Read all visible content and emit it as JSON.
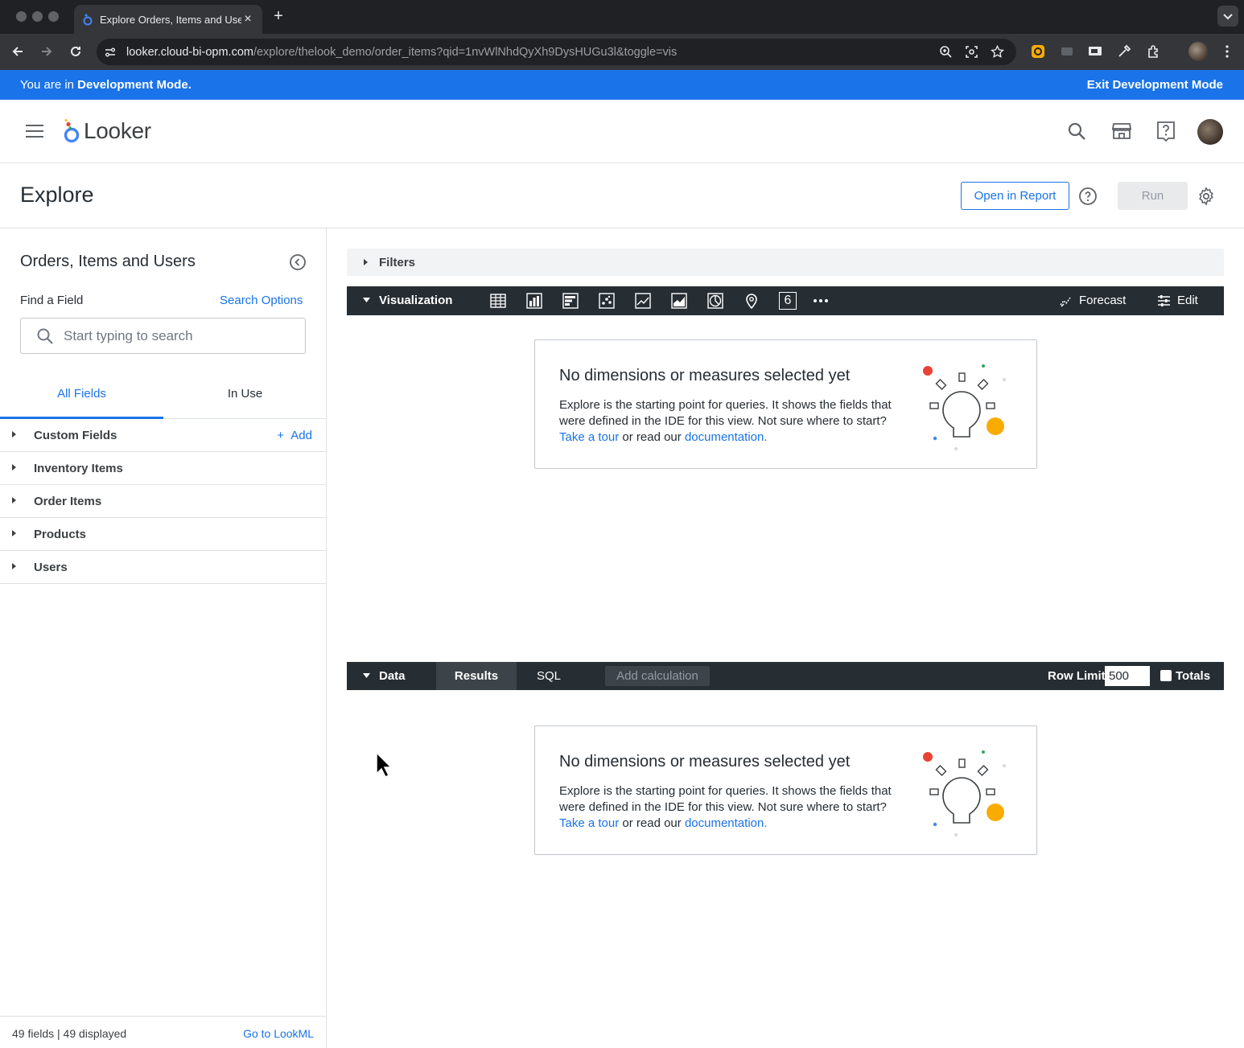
{
  "browser": {
    "tab_title": "Explore Orders, Items and Users",
    "url_host": "looker.cloud-bi-opm.com",
    "url_path": "/explore/thelook_demo/order_items?qid=1nvWlNhdQyXh9DysHUGu3l&toggle=vis"
  },
  "dev_banner": {
    "prefix": "You are in ",
    "mode": "Development Mode.",
    "exit": "Exit Development Mode",
    "color": "#1a73e8"
  },
  "header": {
    "logo_text": "Looker"
  },
  "explore": {
    "title": "Explore",
    "open_in_report": "Open in Report",
    "run": "Run"
  },
  "sidebar": {
    "title": "Orders, Items and Users",
    "find_label": "Find a Field",
    "search_options": "Search Options",
    "search_placeholder": "Start typing to search",
    "tabs": [
      "All Fields",
      "In Use"
    ],
    "views": [
      {
        "label": "Custom Fields",
        "action": "Add"
      },
      {
        "label": "Inventory Items"
      },
      {
        "label": "Order Items"
      },
      {
        "label": "Products"
      },
      {
        "label": "Users"
      }
    ],
    "footer_count": "49 fields | 49 displayed",
    "footer_link": "Go to LookML"
  },
  "filters": {
    "label": "Filters"
  },
  "visualization": {
    "label": "Visualization",
    "types": [
      "table-icon",
      "column-chart-icon",
      "bar-chart-icon",
      "scatter-icon",
      "line-chart-icon",
      "area-chart-icon",
      "pie-chart-icon",
      "map-pin-icon",
      "single-value-icon",
      "more-icon"
    ],
    "single_value_glyph": "6",
    "forecast": "Forecast",
    "edit": "Edit"
  },
  "empty_state": {
    "title": "No dimensions or measures selected yet",
    "body": "Explore is the starting point for queries. It shows the fields that were defined in the IDE for this view. Not sure where to start?",
    "tour_link": "Take a tour",
    "middle": " or read our ",
    "doc_link": "documentation."
  },
  "data_panel": {
    "label": "Data",
    "results": "Results",
    "sql": "SQL",
    "add_calculation": "Add calculation",
    "row_limit_label": "Row Limit",
    "row_limit": "500",
    "totals": "Totals"
  }
}
